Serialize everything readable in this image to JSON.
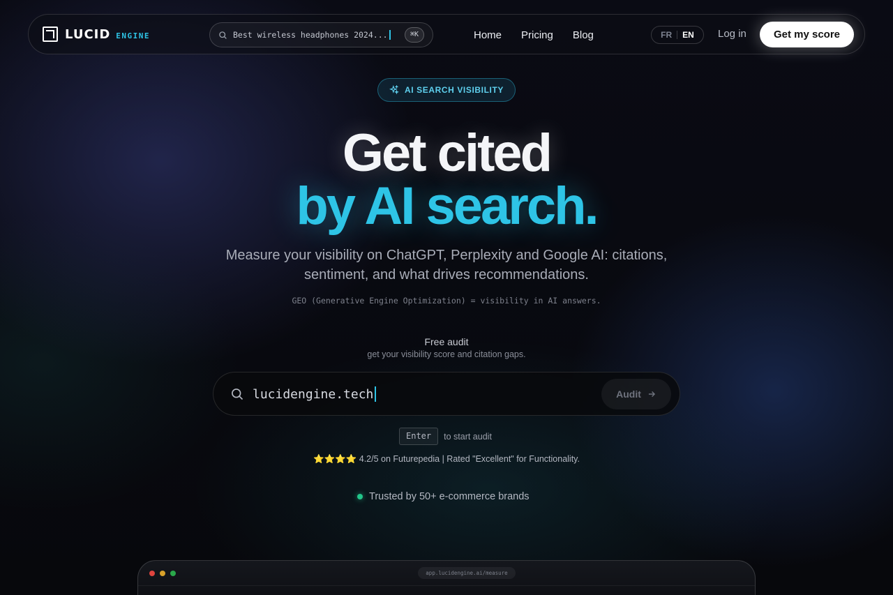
{
  "brand": {
    "name": "LUCID",
    "suffix": "ENGINE"
  },
  "nav": {
    "search_query": "Best wireless headphones 2024...",
    "search_shortcut": "⌘K",
    "links": [
      "Home",
      "Pricing",
      "Blog"
    ],
    "lang_fr": "FR",
    "lang_en": "EN",
    "login": "Log in",
    "cta": "Get my score"
  },
  "hero": {
    "badge": "AI SEARCH VISIBILITY",
    "title_line1": "Get cited",
    "title_line2": "by AI search.",
    "subtitle": "Measure your visibility on ChatGPT, Perplexity and Google AI: citations, sentiment, and what drives recommendations.",
    "geo_note": "GEO (Generative Engine Optimization) = visibility in AI answers."
  },
  "audit": {
    "label": "Free audit",
    "sublabel": "get your visibility score and citation gaps.",
    "input_value": "lucidengine.tech",
    "button": "Audit",
    "enter_key": "Enter",
    "enter_hint": "to start audit"
  },
  "rating": {
    "stars": "⭐⭐⭐⭐",
    "text": "4.2/5 on Futurepedia | Rated \"Excellent\" for Functionality."
  },
  "trusted": "Trusted by 50+ e-commerce brands",
  "mock": {
    "url": "app.lucidengine.ai/measure"
  },
  "colors": {
    "accent": "#2ec4e6",
    "success": "#22c58a"
  }
}
